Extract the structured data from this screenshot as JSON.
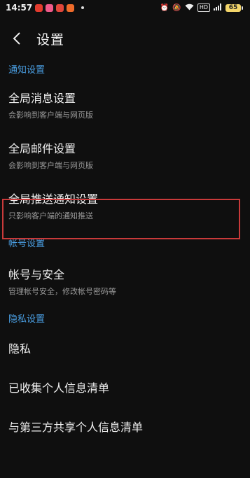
{
  "status_bar": {
    "time": "14:57",
    "badges": [
      "HD"
    ],
    "battery": "65",
    "app_icon_colors": [
      "#e23b2e",
      "#f05a8a",
      "#e0463a",
      "#ef6b2a"
    ]
  },
  "header": {
    "title": "设置"
  },
  "sections": [
    {
      "title": "通知设置",
      "items": [
        {
          "title": "全局消息设置",
          "subtitle": "会影响到客户端与网页版"
        },
        {
          "title": "全局邮件设置",
          "subtitle": "会影响到客户端与网页版"
        },
        {
          "title": "全局推送通知设置",
          "subtitle": "只影响客户端的通知推送"
        }
      ]
    },
    {
      "title": "帐号设置",
      "items": [
        {
          "title": "帐号与安全",
          "subtitle": "管理帐号安全，修改帐号密码等"
        }
      ]
    },
    {
      "title": "隐私设置",
      "items": [
        {
          "title": "隐私"
        },
        {
          "title": "已收集个人信息清单"
        },
        {
          "title": "与第三方共享个人信息清单"
        }
      ]
    }
  ],
  "colors": {
    "background": "#0f0f0f",
    "section_accent": "#4a9fe3",
    "highlight": "#c93a3a"
  }
}
